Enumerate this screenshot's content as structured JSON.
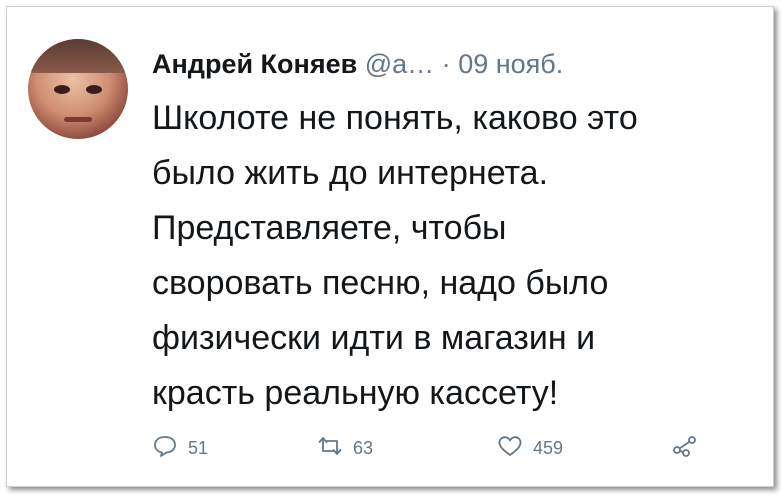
{
  "tweet": {
    "author_name": "Андрей Коняев",
    "handle": "@а…",
    "separator": "·",
    "date": "09 нояб.",
    "text_lines": [
      "Школоте не понять, каково это",
      "было жить до интернета.",
      "Представляете, чтобы",
      "своровать песню, надо было",
      "физически идти в магазин и",
      "красть реальную кассету!"
    ]
  },
  "actions": {
    "reply": {
      "icon": "reply-icon",
      "count": "51"
    },
    "retweet": {
      "icon": "retweet-icon",
      "count": "63"
    },
    "like": {
      "icon": "heart-icon",
      "count": "459"
    },
    "share": {
      "icon": "share-icon"
    }
  },
  "colors": {
    "text": "#14171a",
    "muted": "#657786"
  }
}
